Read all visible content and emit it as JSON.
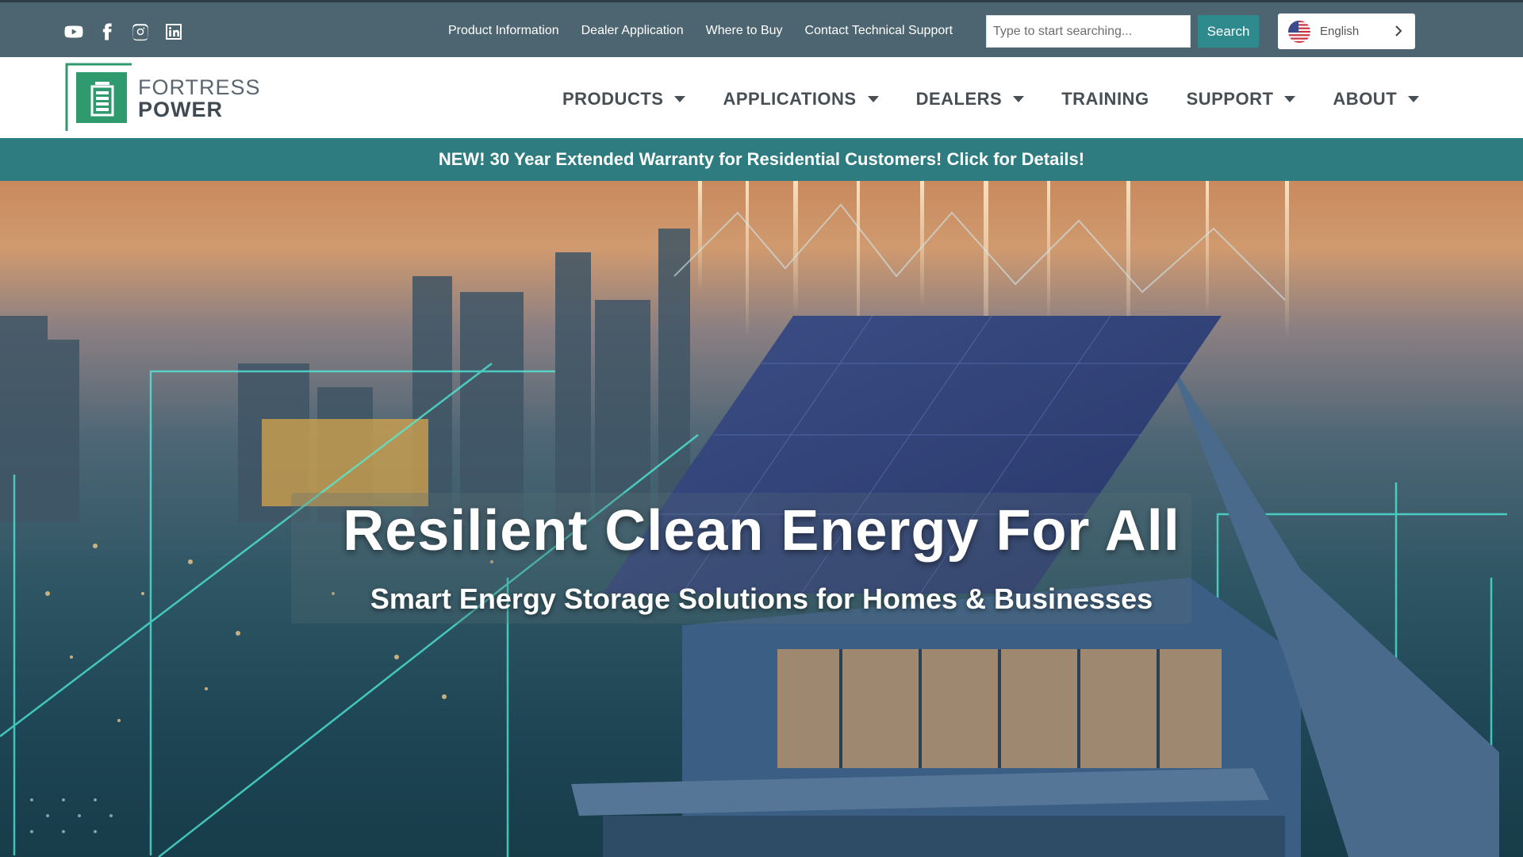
{
  "social": [
    {
      "name": "youtube-icon"
    },
    {
      "name": "facebook-icon"
    },
    {
      "name": "instagram-icon"
    },
    {
      "name": "linkedin-icon"
    }
  ],
  "toplinks": [
    {
      "label": "Product Information"
    },
    {
      "label": "Dealer Application"
    },
    {
      "label": "Where to Buy"
    },
    {
      "label": "Contact Technical Support"
    }
  ],
  "search": {
    "placeholder": "Type to start searching...",
    "button_label": "Search"
  },
  "language": {
    "label": "English",
    "flag_icon": "us-flag-icon"
  },
  "logo": {
    "line1": "FORTRESS",
    "line2": "POWER"
  },
  "nav": [
    {
      "label": "PRODUCTS",
      "has_dropdown": true
    },
    {
      "label": "APPLICATIONS",
      "has_dropdown": true
    },
    {
      "label": "DEALERS",
      "has_dropdown": true
    },
    {
      "label": "TRAINING",
      "has_dropdown": false
    },
    {
      "label": "SUPPORT",
      "has_dropdown": true
    },
    {
      "label": "ABOUT",
      "has_dropdown": true
    }
  ],
  "banner": {
    "text": "NEW! 30 Year Extended Warranty for Residential Customers! Click for Details!"
  },
  "hero": {
    "title": "Resilient Clean Energy For All",
    "subtitle": "Smart Energy Storage Solutions for Homes & Businesses"
  },
  "colors": {
    "topbar": "#4c6570",
    "accent_teal": "#2f8a8d",
    "banner": "#2f7c80",
    "logo_green": "#2e9a6e",
    "nav_text": "#474e54"
  }
}
